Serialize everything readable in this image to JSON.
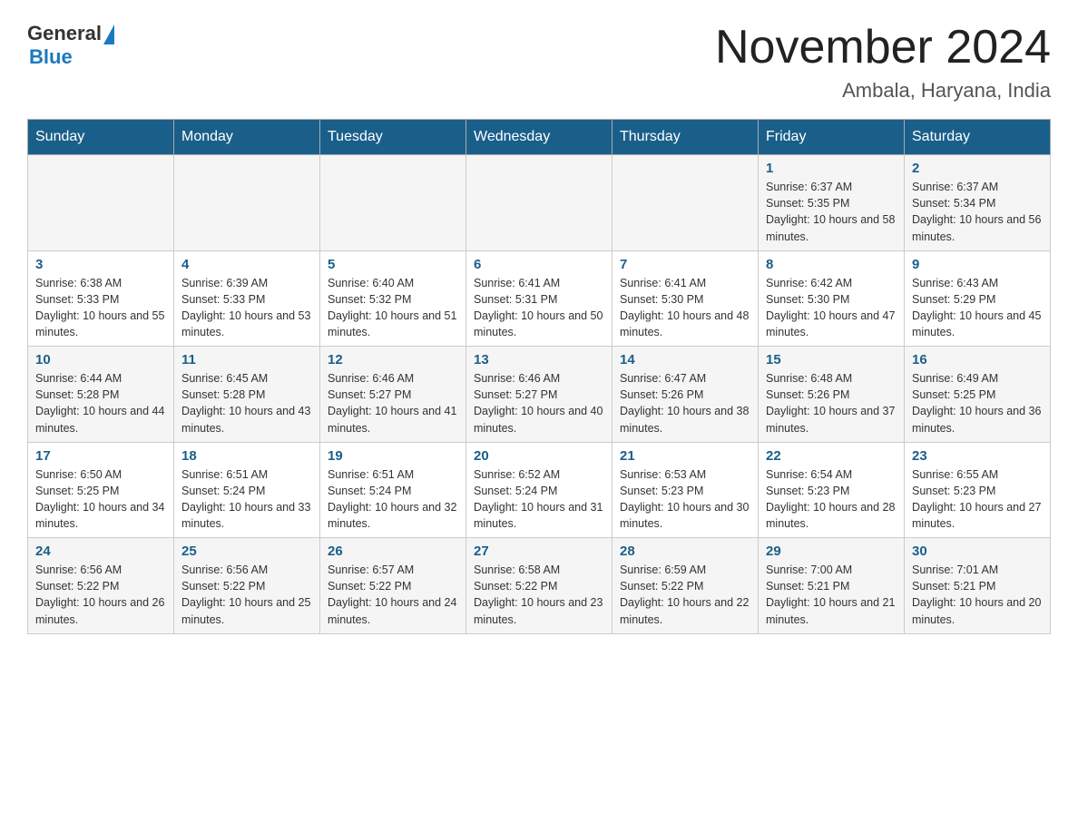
{
  "header": {
    "logo_general": "General",
    "logo_blue": "Blue",
    "month_title": "November 2024",
    "location": "Ambala, Haryana, India"
  },
  "days_of_week": [
    "Sunday",
    "Monday",
    "Tuesday",
    "Wednesday",
    "Thursday",
    "Friday",
    "Saturday"
  ],
  "weeks": [
    [
      {
        "day": "",
        "info": ""
      },
      {
        "day": "",
        "info": ""
      },
      {
        "day": "",
        "info": ""
      },
      {
        "day": "",
        "info": ""
      },
      {
        "day": "",
        "info": ""
      },
      {
        "day": "1",
        "info": "Sunrise: 6:37 AM\nSunset: 5:35 PM\nDaylight: 10 hours and 58 minutes."
      },
      {
        "day": "2",
        "info": "Sunrise: 6:37 AM\nSunset: 5:34 PM\nDaylight: 10 hours and 56 minutes."
      }
    ],
    [
      {
        "day": "3",
        "info": "Sunrise: 6:38 AM\nSunset: 5:33 PM\nDaylight: 10 hours and 55 minutes."
      },
      {
        "day": "4",
        "info": "Sunrise: 6:39 AM\nSunset: 5:33 PM\nDaylight: 10 hours and 53 minutes."
      },
      {
        "day": "5",
        "info": "Sunrise: 6:40 AM\nSunset: 5:32 PM\nDaylight: 10 hours and 51 minutes."
      },
      {
        "day": "6",
        "info": "Sunrise: 6:41 AM\nSunset: 5:31 PM\nDaylight: 10 hours and 50 minutes."
      },
      {
        "day": "7",
        "info": "Sunrise: 6:41 AM\nSunset: 5:30 PM\nDaylight: 10 hours and 48 minutes."
      },
      {
        "day": "8",
        "info": "Sunrise: 6:42 AM\nSunset: 5:30 PM\nDaylight: 10 hours and 47 minutes."
      },
      {
        "day": "9",
        "info": "Sunrise: 6:43 AM\nSunset: 5:29 PM\nDaylight: 10 hours and 45 minutes."
      }
    ],
    [
      {
        "day": "10",
        "info": "Sunrise: 6:44 AM\nSunset: 5:28 PM\nDaylight: 10 hours and 44 minutes."
      },
      {
        "day": "11",
        "info": "Sunrise: 6:45 AM\nSunset: 5:28 PM\nDaylight: 10 hours and 43 minutes."
      },
      {
        "day": "12",
        "info": "Sunrise: 6:46 AM\nSunset: 5:27 PM\nDaylight: 10 hours and 41 minutes."
      },
      {
        "day": "13",
        "info": "Sunrise: 6:46 AM\nSunset: 5:27 PM\nDaylight: 10 hours and 40 minutes."
      },
      {
        "day": "14",
        "info": "Sunrise: 6:47 AM\nSunset: 5:26 PM\nDaylight: 10 hours and 38 minutes."
      },
      {
        "day": "15",
        "info": "Sunrise: 6:48 AM\nSunset: 5:26 PM\nDaylight: 10 hours and 37 minutes."
      },
      {
        "day": "16",
        "info": "Sunrise: 6:49 AM\nSunset: 5:25 PM\nDaylight: 10 hours and 36 minutes."
      }
    ],
    [
      {
        "day": "17",
        "info": "Sunrise: 6:50 AM\nSunset: 5:25 PM\nDaylight: 10 hours and 34 minutes."
      },
      {
        "day": "18",
        "info": "Sunrise: 6:51 AM\nSunset: 5:24 PM\nDaylight: 10 hours and 33 minutes."
      },
      {
        "day": "19",
        "info": "Sunrise: 6:51 AM\nSunset: 5:24 PM\nDaylight: 10 hours and 32 minutes."
      },
      {
        "day": "20",
        "info": "Sunrise: 6:52 AM\nSunset: 5:24 PM\nDaylight: 10 hours and 31 minutes."
      },
      {
        "day": "21",
        "info": "Sunrise: 6:53 AM\nSunset: 5:23 PM\nDaylight: 10 hours and 30 minutes."
      },
      {
        "day": "22",
        "info": "Sunrise: 6:54 AM\nSunset: 5:23 PM\nDaylight: 10 hours and 28 minutes."
      },
      {
        "day": "23",
        "info": "Sunrise: 6:55 AM\nSunset: 5:23 PM\nDaylight: 10 hours and 27 minutes."
      }
    ],
    [
      {
        "day": "24",
        "info": "Sunrise: 6:56 AM\nSunset: 5:22 PM\nDaylight: 10 hours and 26 minutes."
      },
      {
        "day": "25",
        "info": "Sunrise: 6:56 AM\nSunset: 5:22 PM\nDaylight: 10 hours and 25 minutes."
      },
      {
        "day": "26",
        "info": "Sunrise: 6:57 AM\nSunset: 5:22 PM\nDaylight: 10 hours and 24 minutes."
      },
      {
        "day": "27",
        "info": "Sunrise: 6:58 AM\nSunset: 5:22 PM\nDaylight: 10 hours and 23 minutes."
      },
      {
        "day": "28",
        "info": "Sunrise: 6:59 AM\nSunset: 5:22 PM\nDaylight: 10 hours and 22 minutes."
      },
      {
        "day": "29",
        "info": "Sunrise: 7:00 AM\nSunset: 5:21 PM\nDaylight: 10 hours and 21 minutes."
      },
      {
        "day": "30",
        "info": "Sunrise: 7:01 AM\nSunset: 5:21 PM\nDaylight: 10 hours and 20 minutes."
      }
    ]
  ]
}
